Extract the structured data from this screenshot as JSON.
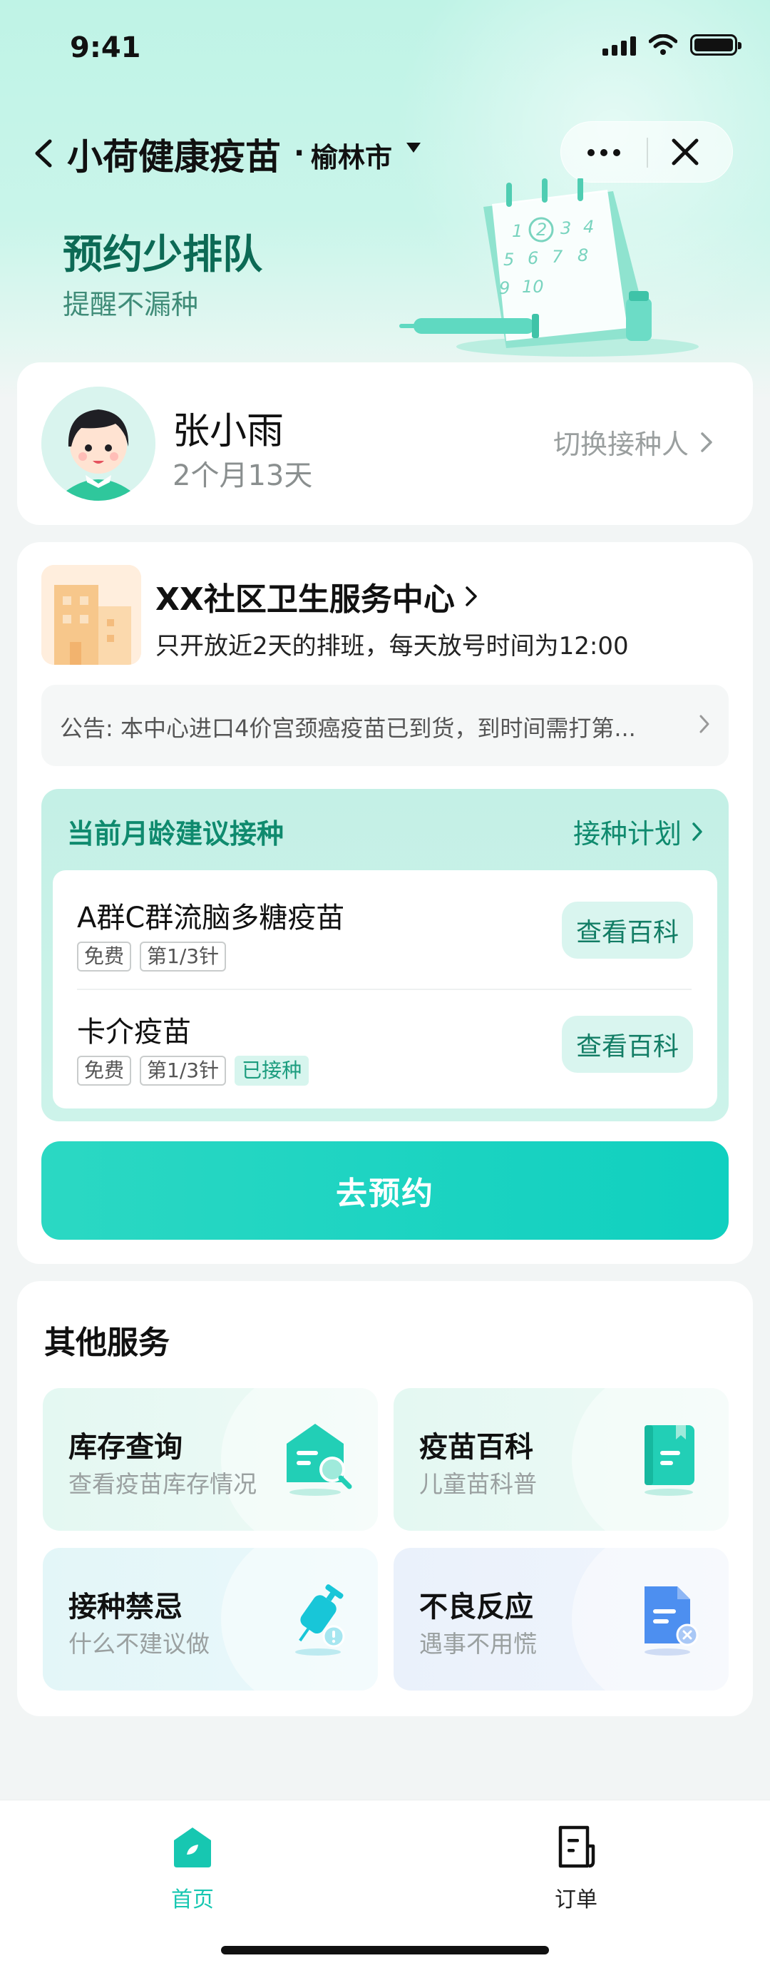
{
  "status_bar": {
    "time": "9:41"
  },
  "nav": {
    "title": "小荷健康疫苗",
    "separator": "·",
    "city": "榆林市"
  },
  "hero": {
    "title": "预约少排队",
    "subtitle": "提醒不漏种",
    "calendar_numbers": [
      "1",
      "2",
      "3",
      "4",
      "5",
      "6",
      "7",
      "8",
      "9",
      "10"
    ]
  },
  "person": {
    "name": "张小雨",
    "age": "2个月13天",
    "switch_label": "切换接种人"
  },
  "clinic": {
    "name": "XX社区卫生服务中心",
    "note": "只开放近2天的排班，每天放号时间为12:00",
    "notice": "公告: 本中心进口4价宫颈癌疫苗已到货，到时间需打第..."
  },
  "recommend": {
    "title": "当前月龄建议接种",
    "plan_label": "接种计划",
    "vaccines": [
      {
        "name": "A群C群流脑多糖疫苗",
        "tags": [
          "免费",
          "第1/3针"
        ],
        "status": "",
        "button": "查看百科"
      },
      {
        "name": "卡介疫苗",
        "tags": [
          "免费",
          "第1/3针"
        ],
        "status": "已接种",
        "button": "查看百科"
      }
    ]
  },
  "book_button": "去预约",
  "services": {
    "title": "其他服务",
    "items": [
      {
        "title": "库存查询",
        "subtitle": "查看疫苗库存情况",
        "icon": "inventory-search-icon",
        "color": "#1fcfb8"
      },
      {
        "title": "疫苗百科",
        "subtitle": "儿童苗科普",
        "icon": "book-icon",
        "color": "#1fcfb8"
      },
      {
        "title": "接种禁忌",
        "subtitle": "什么不建议做",
        "icon": "syringe-warning-icon",
        "color": "#18c6d8"
      },
      {
        "title": "不良反应",
        "subtitle": "遇事不用慌",
        "icon": "document-error-icon",
        "color": "#4d8ff0"
      }
    ]
  },
  "tabbar": {
    "items": [
      {
        "label": "首页",
        "icon": "home-icon",
        "active": true
      },
      {
        "label": "订单",
        "icon": "order-icon",
        "active": false
      }
    ],
    "active_color": "#17c7b1"
  },
  "colors": {
    "brand": "#17c7b1",
    "dark_green": "#0c6a55"
  }
}
